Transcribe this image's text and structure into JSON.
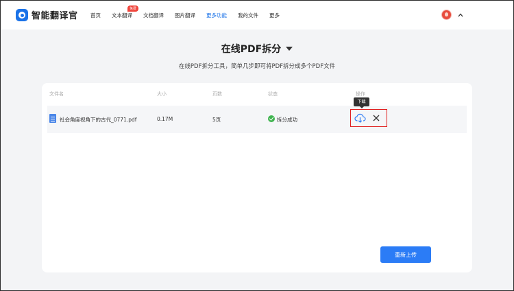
{
  "app": {
    "name": "智能翻译官"
  },
  "nav": {
    "items": [
      {
        "label": "首页"
      },
      {
        "label": "文本翻译",
        "badge": "免费"
      },
      {
        "label": "文档翻译"
      },
      {
        "label": "图片翻译"
      },
      {
        "label": "更多功能",
        "active": true
      },
      {
        "label": "我的文件"
      },
      {
        "label": "更多"
      }
    ]
  },
  "page": {
    "title": "在线PDF拆分",
    "subtitle": "在线PDF拆分工具，简单几步即可将PDF拆分成多个PDF文件"
  },
  "table": {
    "columns": [
      "文件名",
      "大小",
      "页数",
      "状态",
      "操作"
    ],
    "rows": [
      {
        "filename": "社会角度视角下的古代_0771.pdf",
        "size": "0.17M",
        "pages": "5页",
        "status": "拆分成功"
      }
    ]
  },
  "actions": {
    "tooltip": "下载",
    "reupload": "重新上传"
  },
  "colors": {
    "accent": "#2b7cf6",
    "success": "#3fb44f",
    "badge": "#f0433a",
    "highlight": "#e02020"
  },
  "icons": [
    "logo-icon",
    "file-pdf-icon",
    "check-circle-icon",
    "cloud-download-icon",
    "close-icon",
    "chevron-up-icon",
    "avatar"
  ]
}
